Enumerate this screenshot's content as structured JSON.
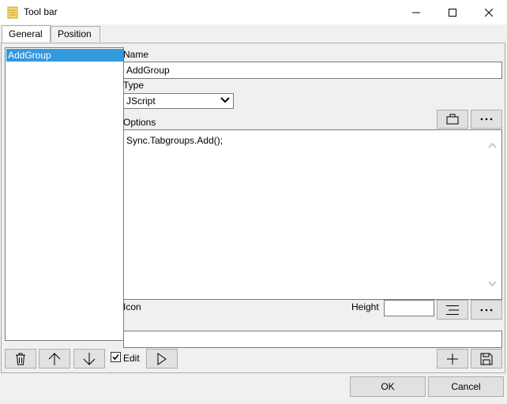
{
  "window": {
    "title": "Tool bar"
  },
  "tabs": [
    {
      "label": "General",
      "active": true
    },
    {
      "label": "Position",
      "active": false
    }
  ],
  "list": {
    "items": [
      {
        "label": "AddGroup",
        "selected": true
      }
    ]
  },
  "form": {
    "name_label": "Name",
    "name_value": "AddGroup",
    "type_label": "Type",
    "type_value": "JScript",
    "options_label": "Options",
    "options_value": "Sync.Tabgroups.Add();",
    "icon_label": "Icon",
    "height_label": "Height",
    "height_value": "",
    "icon_value": ""
  },
  "controls": {
    "edit_label": "Edit",
    "edit_checked": true,
    "ok_label": "OK",
    "cancel_label": "Cancel",
    "more_options_label": "...",
    "more_height_label": "..."
  },
  "colors": {
    "selection": "#3399dd",
    "window_bg": "#f0f0f0",
    "button_bg": "#e1e1e1"
  }
}
